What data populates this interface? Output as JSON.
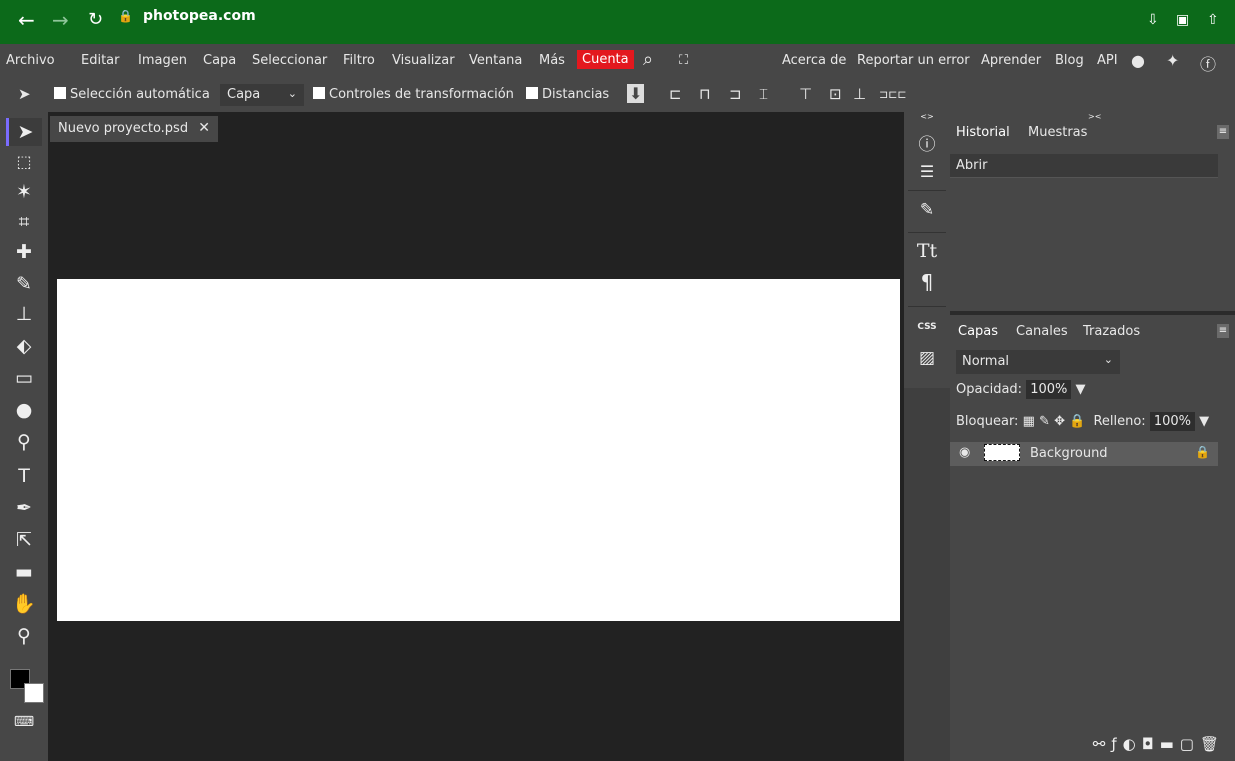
{
  "browser": {
    "url": "photopea.com"
  },
  "menu": {
    "items": [
      "Archivo",
      "Editar",
      "Imagen",
      "Capa",
      "Seleccionar",
      "Filtro",
      "Visualizar",
      "Ventana",
      "Más"
    ],
    "account": "Cuenta",
    "links": [
      "Acerca de",
      "Reportar un error",
      "Aprender",
      "Blog",
      "API"
    ]
  },
  "options": {
    "auto_select": "Selección automática",
    "target": "Capa",
    "transform_controls": "Controles de transformación",
    "distances": "Distancias"
  },
  "document": {
    "tab_title": "Nuevo proyecto.psd",
    "close": "✕"
  },
  "history_panel": {
    "tabs": [
      "Historial",
      "Muestras"
    ],
    "entries": [
      "Abrir"
    ]
  },
  "layers_panel": {
    "tabs": [
      "Capas",
      "Canales",
      "Trazados"
    ],
    "blend_mode": "Normal",
    "opacity_label": "Opacidad:",
    "opacity_value": "100%",
    "lock_label": "Bloquear:",
    "fill_label": "Relleno:",
    "fill_value": "100%",
    "layers": [
      {
        "name": "Background"
      }
    ]
  },
  "mid_panel": {
    "css_label": "CSS"
  },
  "colors": {
    "accent": "#7a6cff",
    "account": "#e3181e",
    "browser": "#0c6a1a"
  }
}
